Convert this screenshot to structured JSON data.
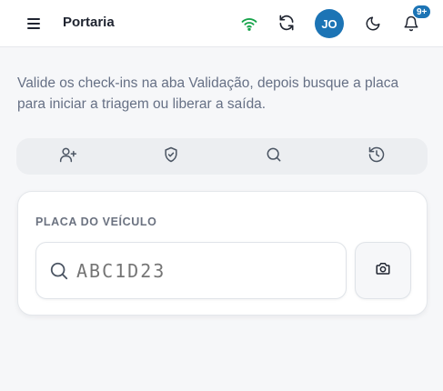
{
  "header": {
    "title": "Portaria",
    "avatar_initials": "JO",
    "notification_badge": "9+",
    "icons": [
      "menu-icon",
      "wifi-icon",
      "sync-icon",
      "moon-icon",
      "bell-icon"
    ]
  },
  "intro_text": "Valide os check-ins na aba Validação, depois busque a placa para iniciar a triagem ou liberar a saída.",
  "tabs": [
    {
      "icon": "user-plus-icon"
    },
    {
      "icon": "shield-check-icon"
    },
    {
      "icon": "search-icon"
    },
    {
      "icon": "history-icon"
    }
  ],
  "plate_form": {
    "label": "PLACA DO VEÍCULO",
    "placeholder": "ABC1D23"
  },
  "colors": {
    "accent": "#1c74b5",
    "wifi": "#16a34a",
    "background": "#f6f7f9"
  }
}
